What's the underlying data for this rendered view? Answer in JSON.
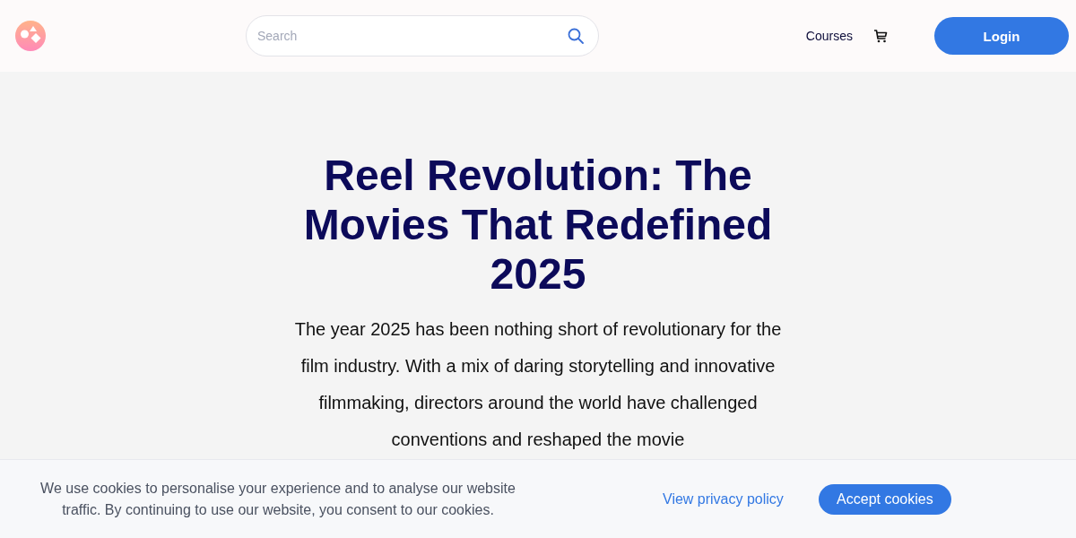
{
  "header": {
    "search": {
      "placeholder": "Search"
    },
    "nav": [
      "Courses"
    ],
    "login": "Login"
  },
  "article": {
    "title": "Reel Revolution: The Movies That Redefined 2025",
    "intro": "The year 2025 has been nothing short of revolutionary for the film industry. With a mix of daring storytelling and innovative filmmaking, directors around the world have challenged conventions and reshaped the movie"
  },
  "cookie_banner": {
    "message": "We use cookies to personalise your experience and to analyse our website traffic. By continuing to use our website, you consent to our cookies.",
    "link": "View privacy policy",
    "button": "Accept cookies"
  }
}
